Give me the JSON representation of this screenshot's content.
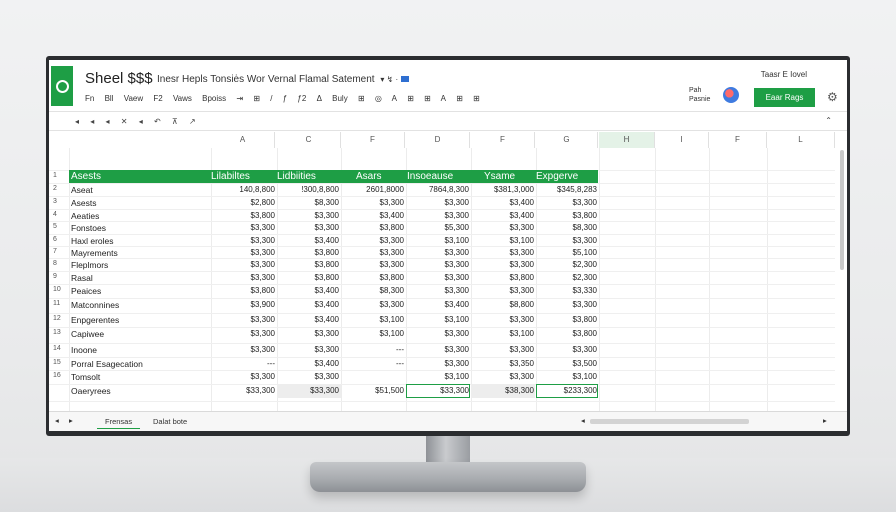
{
  "app": {
    "title": "Sheel $$$",
    "menu": [
      "Inesr",
      "Hepls",
      "Tonsiės",
      "Wor",
      "Vernal Flamal Satement"
    ],
    "toolbar": [
      "Fn",
      "Bll",
      "Vaew",
      "F2",
      "Vaws",
      "Bpoiss",
      "⇥",
      "⊞",
      "/",
      "ƒ",
      "ƒ2",
      "Δ",
      "Buly",
      "⊞",
      "◎",
      "A",
      "⊞",
      "⊞",
      "A",
      "⊞",
      "⊞"
    ],
    "top_right": "Taasr  E  Iovel",
    "side_small": [
      "Pah",
      "Pasnie"
    ],
    "share_button": "Eaar Rags",
    "formula_icons": [
      "◂",
      "◂",
      "◂",
      "✕",
      "◂",
      "↶",
      "⊼",
      "↗"
    ]
  },
  "columns": [
    "A",
    "C",
    "F",
    "D",
    "F",
    "G",
    "H",
    "I",
    "F",
    "L"
  ],
  "row_numbers": [
    "1",
    "2",
    "3",
    "4",
    "5",
    "6",
    "7",
    "8",
    "9",
    "10",
    "11",
    "12",
    "13",
    "14",
    "15",
    "16"
  ],
  "table": {
    "headers": [
      "Asests",
      "Lilabiltes",
      "Lidbiities",
      "Asars",
      "Insoeause",
      "Ysame",
      "Expgerve"
    ],
    "rows": [
      [
        "Aseat",
        "140,8,800",
        "!300,8,800",
        "2601,8000",
        "7864,8,300",
        "$381,3,000",
        "$345,8,283"
      ],
      [
        "Asests",
        "$2,800",
        "$8,300",
        "$3,300",
        "$3,300",
        "$3,400",
        "$3,300"
      ],
      [
        "Aeaties",
        "$3,800",
        "$3,300",
        "$3,400",
        "$3,300",
        "$3,400",
        "$3,800"
      ],
      [
        "Fonstoes",
        "$3,300",
        "$3,300",
        "$3,800",
        "$5,300",
        "$3,300",
        "$8,300"
      ],
      [
        "Haxl eroles",
        "$3,300",
        "$3,400",
        "$3,300",
        "$3,100",
        "$3,100",
        "$3,300"
      ],
      [
        "Mayrements",
        "$3,300",
        "$3,800",
        "$3,300",
        "$3,300",
        "$3,300",
        "$5,100"
      ],
      [
        "Fleplmors",
        "$3,300",
        "$3,800",
        "$3,300",
        "$3,300",
        "$3,300",
        "$2,300"
      ],
      [
        "Rasal",
        "$3,300",
        "$3,800",
        "$3,800",
        "$3,300",
        "$3,800",
        "$2,300"
      ],
      [
        "Peaices",
        "$3,800",
        "$3,400",
        "$8,300",
        "$3,300",
        "$3,300",
        "$3,330"
      ],
      [
        "Matconnines",
        "$3,900",
        "$3,400",
        "$3,300",
        "$3,400",
        "$8,800",
        "$3,300"
      ],
      [
        "Enpgerentes",
        "$3,300",
        "$3,400",
        "$3,100",
        "$3,100",
        "$3,300",
        "$3,800"
      ],
      [
        "Capiwee",
        "$3,300",
        "$3,300",
        "$3,100",
        "$3,300",
        "$3,100",
        "$3,800"
      ],
      [
        "Inoone",
        "$3,300",
        "$3,300",
        "---",
        "$3,300",
        "$3,300",
        "$3,300"
      ],
      [
        "Porral Esagecation",
        "---",
        "$3,400",
        "---",
        "$3,300",
        "$3,350",
        "$3,500"
      ],
      [
        "Tomsolt",
        "$3,300",
        "$3,300",
        "",
        "$3,100",
        "$3,300",
        "$3,100"
      ],
      [
        "Oaeryrees",
        "$33,300",
        "$33,300",
        "$51,500",
        "$33,300",
        "$38,300",
        "$233,300"
      ]
    ]
  },
  "sheet_tabs": [
    "Frensas",
    "Dalat bote"
  ],
  "bottom_arrows": [
    "◂",
    "▸",
    "◂",
    "▸"
  ]
}
